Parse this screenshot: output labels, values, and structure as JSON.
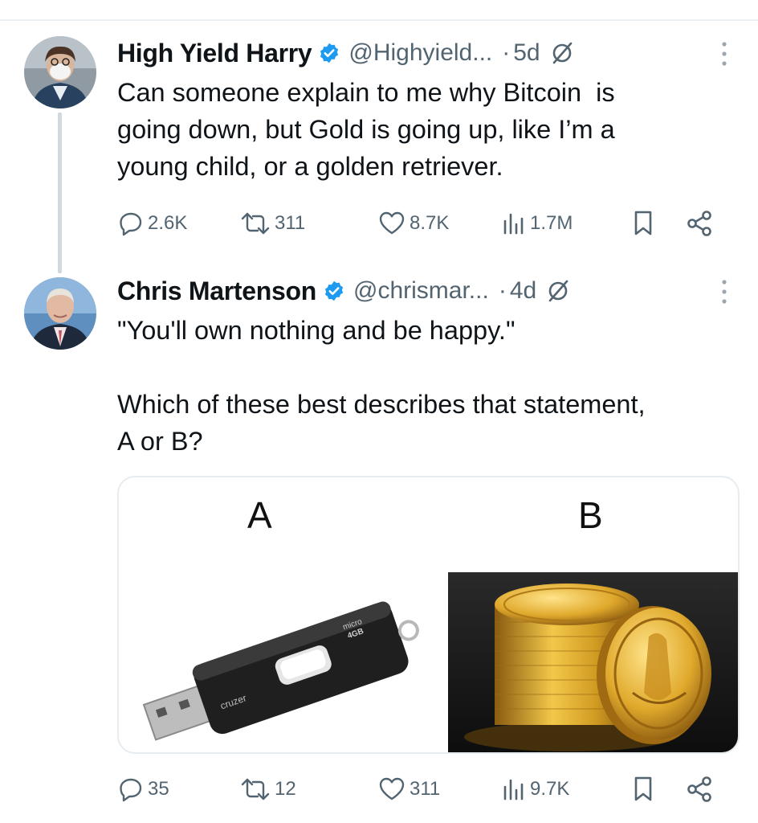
{
  "tweets": [
    {
      "name": "High Yield Harry",
      "handle": "@Highyield...",
      "time_sep": "·",
      "time": "5d",
      "text": "Can someone explain to me why Bitcoin  is\ngoing down, but Gold is going up, like I’m a\nyoung child, or a golden retriever.",
      "stats": {
        "replies": "2.6K",
        "reposts": "311",
        "likes": "8.7K",
        "views": "1.7M"
      }
    },
    {
      "name": "Chris Martenson",
      "handle": "@chrismar...",
      "time_sep": "·",
      "time": "4d",
      "text": "\"You'll own nothing and be happy.\"\n\nWhich of these best describes that statement,\nA or B?",
      "media": {
        "left_label": "A",
        "right_label": "B",
        "usb_brand": "cruzer",
        "usb_model": "micro",
        "usb_capacity": "4GB"
      },
      "stats": {
        "replies": "35",
        "reposts": "12",
        "likes": "311",
        "views": "9.7K"
      }
    }
  ],
  "icons": {
    "verified": "verified-badge-icon",
    "grok": "grok-icon",
    "more": "more-options-icon",
    "reply": "reply-icon",
    "repost": "repost-icon",
    "like": "like-icon",
    "views": "views-icon",
    "bookmark": "bookmark-icon",
    "share": "share-icon"
  },
  "colors": {
    "verified": "#1d9bf0",
    "secondary_text": "#536471",
    "primary_text": "#0f1419",
    "thread_line": "#cfd9de"
  }
}
